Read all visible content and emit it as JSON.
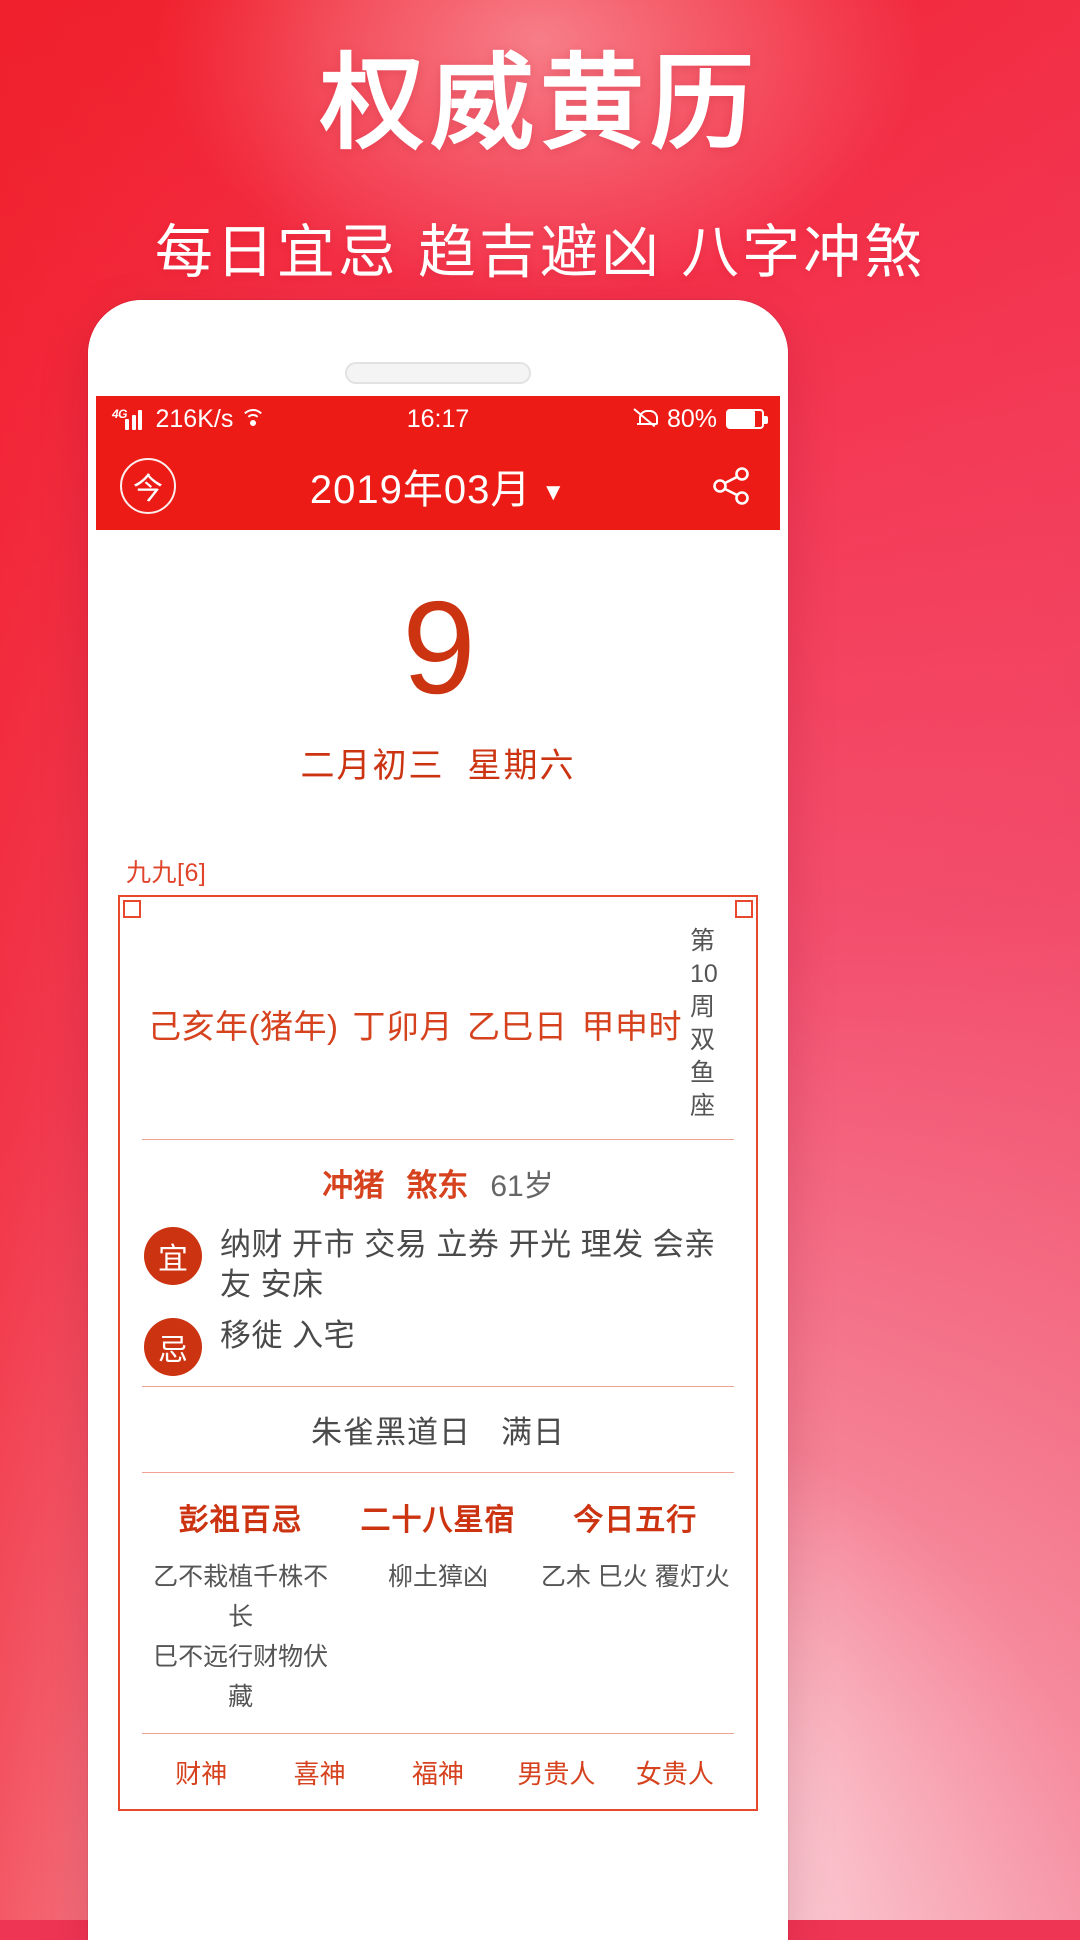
{
  "promo": {
    "title": "权威黄历",
    "subtitle": "每日宜忌 趋吉避凶 八字冲煞"
  },
  "statusbar": {
    "network_type": "4G",
    "speed": "216K/s",
    "time": "16:17",
    "battery_percent": "80%",
    "signal_icon": "signal-bars-icon",
    "wifi_icon": "wifi-icon",
    "mute_icon": "bell-mute-icon",
    "battery_icon": "battery-icon"
  },
  "navbar": {
    "today_label": "今",
    "title": "2019年03月",
    "caret": "▼",
    "share_icon": "share-icon"
  },
  "day": {
    "number": "9",
    "lunar": "二月初三",
    "weekday": "星期六"
  },
  "card": {
    "jiujiu_label": "九九[6]",
    "pillars": [
      "己亥年(猪年)",
      "丁卯月",
      "乙巳日",
      "甲申时"
    ],
    "week_number": "第10周",
    "zodiac_sign": "双鱼座",
    "chong": "冲猪",
    "sha": "煞东",
    "age": "61岁",
    "yi": {
      "badge": "宜",
      "items": "纳财 开市 交易 立券 开光 理发 会亲友 安床"
    },
    "ji": {
      "badge": "忌",
      "items": "移徙 入宅"
    },
    "shen_day": "朱雀黑道日",
    "shen_type": "满日",
    "columns": [
      {
        "title": "彭祖百忌",
        "line1": "乙不栽植千株不长",
        "line2": "巳不远行财物伏藏"
      },
      {
        "title": "二十八星宿",
        "line1": "柳土獐凶",
        "line2": ""
      },
      {
        "title": "今日五行",
        "line1": "乙木 巳火 覆灯火",
        "line2": ""
      }
    ],
    "gods": [
      "财神",
      "喜神",
      "福神",
      "男贵人",
      "女贵人"
    ]
  },
  "colors": {
    "brand_red": "#ec1b16",
    "accent_red": "#cc3311",
    "card_border": "#e8492c",
    "promo_pink": "#f3506f"
  }
}
